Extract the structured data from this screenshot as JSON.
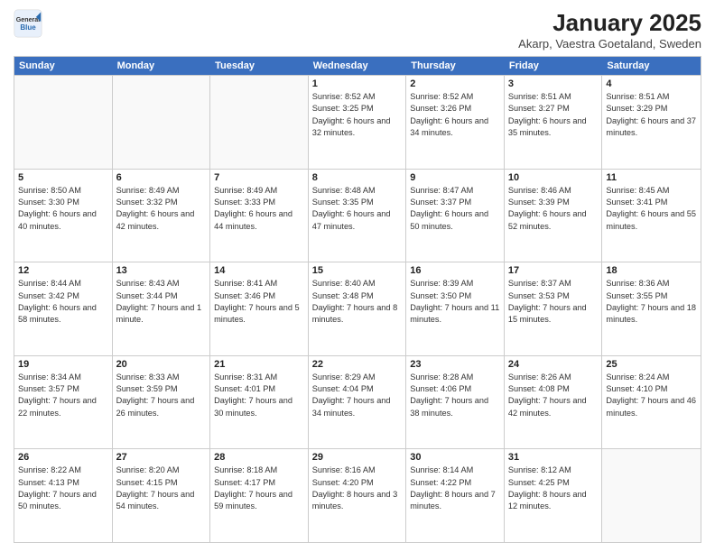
{
  "logo": {
    "general": "General",
    "blue": "Blue"
  },
  "title": "January 2025",
  "subtitle": "Akarp, Vaestra Goetaland, Sweden",
  "days": [
    "Sunday",
    "Monday",
    "Tuesday",
    "Wednesday",
    "Thursday",
    "Friday",
    "Saturday"
  ],
  "weeks": [
    [
      {
        "day": "",
        "info": "",
        "empty": true
      },
      {
        "day": "",
        "info": "",
        "empty": true
      },
      {
        "day": "",
        "info": "",
        "empty": true
      },
      {
        "day": "1",
        "info": "Sunrise: 8:52 AM\nSunset: 3:25 PM\nDaylight: 6 hours and 32 minutes."
      },
      {
        "day": "2",
        "info": "Sunrise: 8:52 AM\nSunset: 3:26 PM\nDaylight: 6 hours and 34 minutes."
      },
      {
        "day": "3",
        "info": "Sunrise: 8:51 AM\nSunset: 3:27 PM\nDaylight: 6 hours and 35 minutes."
      },
      {
        "day": "4",
        "info": "Sunrise: 8:51 AM\nSunset: 3:29 PM\nDaylight: 6 hours and 37 minutes."
      }
    ],
    [
      {
        "day": "5",
        "info": "Sunrise: 8:50 AM\nSunset: 3:30 PM\nDaylight: 6 hours and 40 minutes."
      },
      {
        "day": "6",
        "info": "Sunrise: 8:49 AM\nSunset: 3:32 PM\nDaylight: 6 hours and 42 minutes."
      },
      {
        "day": "7",
        "info": "Sunrise: 8:49 AM\nSunset: 3:33 PM\nDaylight: 6 hours and 44 minutes."
      },
      {
        "day": "8",
        "info": "Sunrise: 8:48 AM\nSunset: 3:35 PM\nDaylight: 6 hours and 47 minutes."
      },
      {
        "day": "9",
        "info": "Sunrise: 8:47 AM\nSunset: 3:37 PM\nDaylight: 6 hours and 50 minutes."
      },
      {
        "day": "10",
        "info": "Sunrise: 8:46 AM\nSunset: 3:39 PM\nDaylight: 6 hours and 52 minutes."
      },
      {
        "day": "11",
        "info": "Sunrise: 8:45 AM\nSunset: 3:41 PM\nDaylight: 6 hours and 55 minutes."
      }
    ],
    [
      {
        "day": "12",
        "info": "Sunrise: 8:44 AM\nSunset: 3:42 PM\nDaylight: 6 hours and 58 minutes."
      },
      {
        "day": "13",
        "info": "Sunrise: 8:43 AM\nSunset: 3:44 PM\nDaylight: 7 hours and 1 minute."
      },
      {
        "day": "14",
        "info": "Sunrise: 8:41 AM\nSunset: 3:46 PM\nDaylight: 7 hours and 5 minutes."
      },
      {
        "day": "15",
        "info": "Sunrise: 8:40 AM\nSunset: 3:48 PM\nDaylight: 7 hours and 8 minutes."
      },
      {
        "day": "16",
        "info": "Sunrise: 8:39 AM\nSunset: 3:50 PM\nDaylight: 7 hours and 11 minutes."
      },
      {
        "day": "17",
        "info": "Sunrise: 8:37 AM\nSunset: 3:53 PM\nDaylight: 7 hours and 15 minutes."
      },
      {
        "day": "18",
        "info": "Sunrise: 8:36 AM\nSunset: 3:55 PM\nDaylight: 7 hours and 18 minutes."
      }
    ],
    [
      {
        "day": "19",
        "info": "Sunrise: 8:34 AM\nSunset: 3:57 PM\nDaylight: 7 hours and 22 minutes."
      },
      {
        "day": "20",
        "info": "Sunrise: 8:33 AM\nSunset: 3:59 PM\nDaylight: 7 hours and 26 minutes."
      },
      {
        "day": "21",
        "info": "Sunrise: 8:31 AM\nSunset: 4:01 PM\nDaylight: 7 hours and 30 minutes."
      },
      {
        "day": "22",
        "info": "Sunrise: 8:29 AM\nSunset: 4:04 PM\nDaylight: 7 hours and 34 minutes."
      },
      {
        "day": "23",
        "info": "Sunrise: 8:28 AM\nSunset: 4:06 PM\nDaylight: 7 hours and 38 minutes."
      },
      {
        "day": "24",
        "info": "Sunrise: 8:26 AM\nSunset: 4:08 PM\nDaylight: 7 hours and 42 minutes."
      },
      {
        "day": "25",
        "info": "Sunrise: 8:24 AM\nSunset: 4:10 PM\nDaylight: 7 hours and 46 minutes."
      }
    ],
    [
      {
        "day": "26",
        "info": "Sunrise: 8:22 AM\nSunset: 4:13 PM\nDaylight: 7 hours and 50 minutes."
      },
      {
        "day": "27",
        "info": "Sunrise: 8:20 AM\nSunset: 4:15 PM\nDaylight: 7 hours and 54 minutes."
      },
      {
        "day": "28",
        "info": "Sunrise: 8:18 AM\nSunset: 4:17 PM\nDaylight: 7 hours and 59 minutes."
      },
      {
        "day": "29",
        "info": "Sunrise: 8:16 AM\nSunset: 4:20 PM\nDaylight: 8 hours and 3 minutes."
      },
      {
        "day": "30",
        "info": "Sunrise: 8:14 AM\nSunset: 4:22 PM\nDaylight: 8 hours and 7 minutes."
      },
      {
        "day": "31",
        "info": "Sunrise: 8:12 AM\nSunset: 4:25 PM\nDaylight: 8 hours and 12 minutes."
      },
      {
        "day": "",
        "info": "",
        "empty": true
      }
    ]
  ]
}
